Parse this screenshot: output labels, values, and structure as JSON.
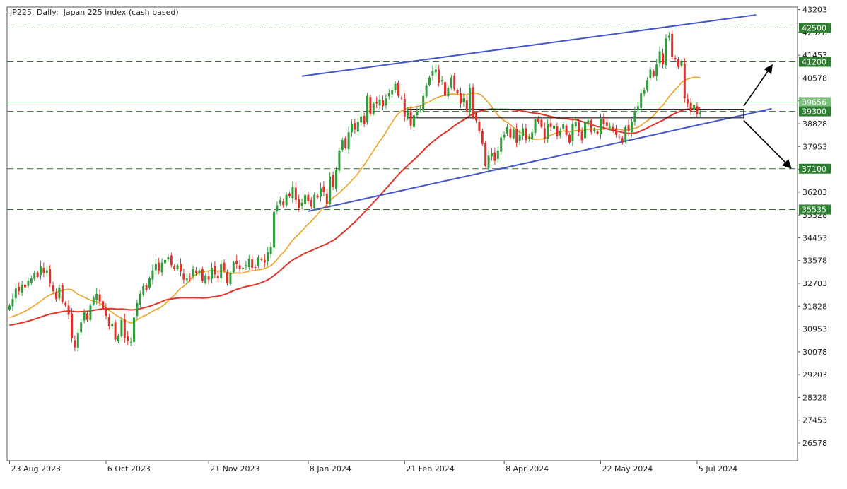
{
  "chart_data": {
    "type": "candlestick",
    "title": "JP225, Daily:  Japan 225 index (cash based)",
    "ylim": [
      25900,
      43300
    ],
    "y_ticks": [
      26578,
      27453,
      28328,
      29203,
      30078,
      30953,
      31828,
      32703,
      33578,
      34453,
      35328,
      36203,
      37078,
      37953,
      38828,
      39703,
      40578,
      41453,
      42328,
      43203
    ],
    "x_ticks": [
      {
        "label": "23 Aug 2023",
        "bar": 0
      },
      {
        "label": "6 Oct 2023",
        "bar": 31
      },
      {
        "label": "21 Nov 2023",
        "bar": 64
      },
      {
        "label": "8 Jan 2024",
        "bar": 96
      },
      {
        "label": "21 Feb 2024",
        "bar": 127
      },
      {
        "label": "8 Apr 2024",
        "bar": 159
      },
      {
        "label": "22 May 2024",
        "bar": 190
      },
      {
        "label": "5 Jul 2024",
        "bar": 221
      }
    ],
    "closes": [
      31850,
      32100,
      32500,
      32400,
      32650,
      32550,
      32800,
      32900,
      33100,
      32950,
      33350,
      33100,
      33200,
      32700,
      32400,
      32100,
      32550,
      32000,
      31850,
      31500,
      30600,
      30250,
      30800,
      31200,
      31600,
      31300,
      31850,
      32150,
      32300,
      32000,
      31700,
      31450,
      31050,
      31150,
      30550,
      30700,
      31300,
      30600,
      30500,
      30450,
      31400,
      31950,
      32300,
      32600,
      32450,
      32900,
      33200,
      33450,
      33200,
      33500,
      33600,
      33700,
      33400,
      33250,
      33400,
      33150,
      32850,
      32900,
      32900,
      33250,
      33100,
      33200,
      32800,
      33000,
      32850,
      33300,
      33050,
      32900,
      33450,
      33200,
      32700,
      33100,
      33500,
      33450,
      33250,
      33300,
      33400,
      33650,
      33300,
      33300,
      33700,
      33600,
      33500,
      33900,
      34100,
      35450,
      35700,
      35900,
      35700,
      36100,
      36050,
      36400,
      35900,
      35600,
      35800,
      36100,
      35850,
      35650,
      36100,
      36000,
      36350,
      36200,
      35750,
      36800,
      36400,
      37050,
      37800,
      38200,
      37900,
      38500,
      38800,
      38600,
      38900,
      39100,
      38800,
      39900,
      39200,
      39600,
      39600,
      39750,
      39500,
      39800,
      40000,
      40100,
      40350,
      39900,
      39800,
      39100,
      39250,
      38750,
      39150,
      39300,
      39400,
      39900,
      40300,
      40600,
      40850,
      40900,
      40400,
      40500,
      39900,
      40200,
      40600,
      40150,
      40000,
      39600,
      39800,
      39300,
      40200,
      39100,
      38950,
      38550,
      38050,
      37200,
      37600,
      37700,
      37400,
      37800,
      38300,
      38400,
      38700,
      38300,
      38600,
      38100,
      38400,
      38650,
      38200,
      38300,
      38500,
      39000,
      38900,
      38700,
      38250,
      38800,
      38700,
      38750,
      38350,
      38550,
      38800,
      38400,
      38100,
      38800,
      38900,
      38500,
      38200,
      38900,
      38950,
      38500,
      38600,
      38450,
      39000,
      38800,
      38750,
      38700,
      38600,
      38400,
      38300,
      38100,
      38700,
      38550,
      38900,
      39300,
      39500,
      40000,
      40100,
      40500,
      40900,
      40650,
      41100,
      41600,
      41100,
      42100,
      42200,
      41400,
      41300,
      41000,
      41200,
      39800,
      39600,
      39300,
      39550,
      39200,
      39250
    ],
    "moving_averages": [
      {
        "color": "#f0a020",
        "closes_ref": "closes",
        "period": 20
      },
      {
        "color": "#e0342a",
        "closes_ref": "closes",
        "period": 50
      }
    ],
    "levels": [
      {
        "value": 42500,
        "label": "42500",
        "style": "dashed",
        "color": "#2f7d32"
      },
      {
        "value": 41200,
        "label": "41200",
        "style": "dashed",
        "color": "#2f7d32"
      },
      {
        "value": 39656,
        "label": "39656",
        "style": "solid",
        "color": "#7fbf7f"
      },
      {
        "value": 39300,
        "label": "39300",
        "style": "dashed",
        "color": "#2f7d32"
      },
      {
        "value": 37100,
        "label": "37100",
        "style": "dashed",
        "color": "#2f7d32"
      },
      {
        "value": 35535,
        "label": "35535",
        "style": "dashed",
        "color": "#2f7d32"
      }
    ],
    "trendlines": [
      {
        "from": [
          96,
          35470
        ],
        "to": [
          245,
          39400
        ],
        "color": "#4455cc"
      },
      {
        "from": [
          94,
          40650
        ],
        "to": [
          240,
          43000
        ],
        "color": "#4455cc"
      }
    ],
    "box": {
      "from_bar": 128,
      "to_bar": 236,
      "low": 39050,
      "high": 39380
    },
    "arrows": [
      {
        "from": [
          236,
          39500
        ],
        "to": [
          245,
          41050
        ],
        "color": "#000000"
      },
      {
        "from": [
          236,
          38950
        ],
        "to": [
          251,
          37150
        ],
        "color": "#000000"
      }
    ],
    "colors": {
      "up": "#2e9e3a",
      "down": "#e0302a",
      "last_label": "#2f7d32"
    }
  }
}
